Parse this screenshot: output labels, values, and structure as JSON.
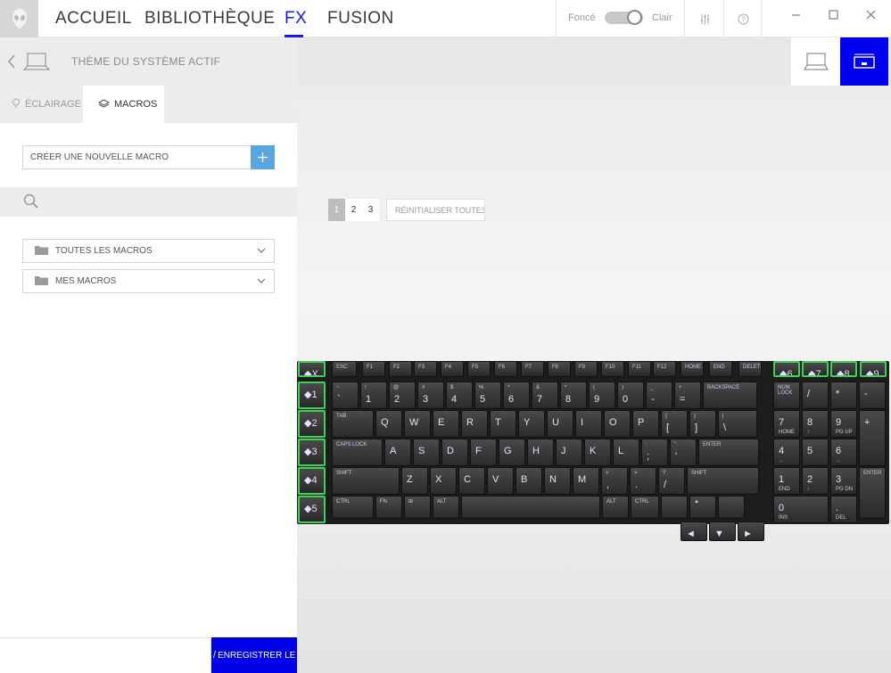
{
  "nav": {
    "tabs": [
      "ACCUEIL",
      "BIBLIOTHÈQUE",
      "FX",
      "FUSION"
    ],
    "active": "FX"
  },
  "theme": {
    "dark_label": "Foncé",
    "light_label": "Clair"
  },
  "panel": {
    "subtitle": "THÈME DU SYSTÈME ACTIF",
    "tabs": {
      "lighting": "ÉCLAIRAGE",
      "macros": "MACROS"
    },
    "create_label": "CRÉER UNE NOUVELLE MACRO",
    "folders": [
      "TOUTES LES MACROS",
      "MES MACROS"
    ],
    "save_label": "ENREGISTRER LE THÈME"
  },
  "pagination": {
    "pages": [
      "1",
      "2",
      "3"
    ],
    "active": "1",
    "reset_label": "RÉINITIALISER TOUTES LES"
  },
  "keyboard": {
    "macro_keys": [
      "X",
      "1",
      "2",
      "3",
      "4",
      "5"
    ],
    "numpad_macro_keys": [
      "6",
      "7",
      "8",
      "9"
    ],
    "rows": [
      [
        [
          "ESC",
          ""
        ],
        [
          "F1",
          ""
        ],
        [
          "F2",
          ""
        ],
        [
          "F3",
          ""
        ],
        [
          "F4",
          ""
        ],
        [
          "F5",
          ""
        ],
        [
          "F6",
          ""
        ],
        [
          "F7",
          ""
        ],
        [
          "F8",
          ""
        ],
        [
          "F9",
          ""
        ],
        [
          "F10",
          ""
        ],
        [
          "F11",
          ""
        ],
        [
          "F12",
          ""
        ],
        [
          "HOME",
          ""
        ],
        [
          "END",
          ""
        ],
        [
          "DELETE",
          ""
        ]
      ],
      [
        [
          "~",
          "`"
        ],
        [
          "!",
          "1"
        ],
        [
          "@",
          "2"
        ],
        [
          "#",
          "3"
        ],
        [
          "$",
          "4"
        ],
        [
          "%",
          "5"
        ],
        [
          "^",
          "6"
        ],
        [
          "&",
          "7"
        ],
        [
          "*",
          "8"
        ],
        [
          "(",
          "9"
        ],
        [
          ")",
          "0"
        ],
        [
          "_",
          "-"
        ],
        [
          "+",
          "="
        ],
        [
          "BACKSPACE",
          ""
        ]
      ],
      [
        [
          "TAB",
          ""
        ],
        [
          "",
          "Q"
        ],
        [
          "",
          "W"
        ],
        [
          "",
          "E"
        ],
        [
          "",
          "R"
        ],
        [
          "",
          "T"
        ],
        [
          "",
          "Y"
        ],
        [
          "",
          "U"
        ],
        [
          "",
          "I"
        ],
        [
          "",
          "O"
        ],
        [
          "",
          "P"
        ],
        [
          "{",
          "["
        ],
        [
          "}",
          "]"
        ],
        [
          "|",
          "\\"
        ]
      ],
      [
        [
          "CAPS LOCK",
          ""
        ],
        [
          "",
          "A"
        ],
        [
          "",
          "S"
        ],
        [
          "",
          "D"
        ],
        [
          "",
          "F"
        ],
        [
          "",
          "G"
        ],
        [
          "",
          "H"
        ],
        [
          "",
          "J"
        ],
        [
          "",
          "K"
        ],
        [
          "",
          "L"
        ],
        [
          ":",
          ";"
        ],
        [
          "\"",
          "'"
        ],
        [
          "ENTER",
          ""
        ]
      ],
      [
        [
          "SHIFT",
          ""
        ],
        [
          "",
          "Z"
        ],
        [
          "",
          "X"
        ],
        [
          "",
          "C"
        ],
        [
          "",
          "V"
        ],
        [
          "",
          "B"
        ],
        [
          "",
          "N"
        ],
        [
          "",
          "M"
        ],
        [
          "<",
          ","
        ],
        [
          ">",
          "."
        ],
        [
          "?",
          "/"
        ],
        [
          "SHIFT",
          ""
        ]
      ],
      [
        [
          "CTRL",
          ""
        ],
        [
          "FN",
          ""
        ],
        [
          "⊞",
          ""
        ],
        [
          "ALT",
          ""
        ],
        [
          "",
          ""
        ],
        [
          "ALT",
          ""
        ],
        [
          "CTRL",
          ""
        ],
        [
          "",
          ""
        ],
        [
          "▲",
          ""
        ],
        [
          "",
          ""
        ]
      ],
      [
        [
          "◄",
          ""
        ],
        [
          "▼",
          ""
        ],
        [
          "►",
          ""
        ]
      ]
    ],
    "numpad": [
      [
        [
          "NUM LOCK",
          ""
        ],
        [
          "",
          "/"
        ],
        [
          "",
          "*"
        ],
        [
          "",
          "-"
        ]
      ],
      [
        [
          "",
          "7",
          "HOME"
        ],
        [
          "",
          "8",
          "↑"
        ],
        [
          "",
          "9",
          "PG UP"
        ],
        [
          "",
          "+"
        ]
      ],
      [
        [
          "",
          "4",
          "←"
        ],
        [
          "",
          "5",
          ""
        ],
        [
          "",
          "6",
          "→"
        ]
      ],
      [
        [
          "",
          "1",
          "END"
        ],
        [
          "",
          "2",
          "↓"
        ],
        [
          "",
          "3",
          "PG DN"
        ],
        [
          "ENTER",
          ""
        ]
      ],
      [
        [
          "",
          "0",
          "INS"
        ],
        [
          "",
          ".",
          "DEL"
        ]
      ]
    ]
  }
}
